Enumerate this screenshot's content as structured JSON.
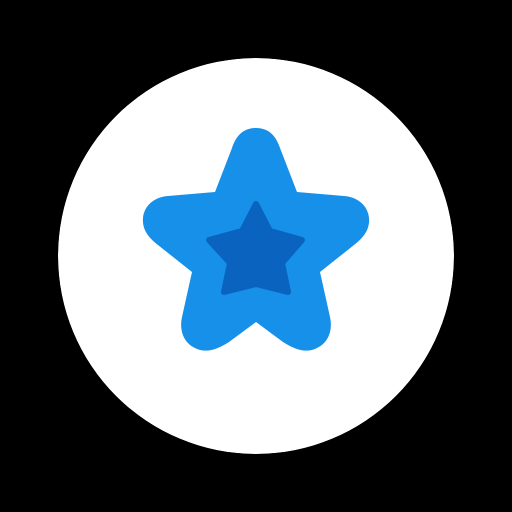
{
  "icon": {
    "name": "star-icon",
    "colors": {
      "background": "#000000",
      "badge": "#FFFFFF",
      "star_outer": "#1690E8",
      "star_inner": "#0A63BE"
    }
  }
}
